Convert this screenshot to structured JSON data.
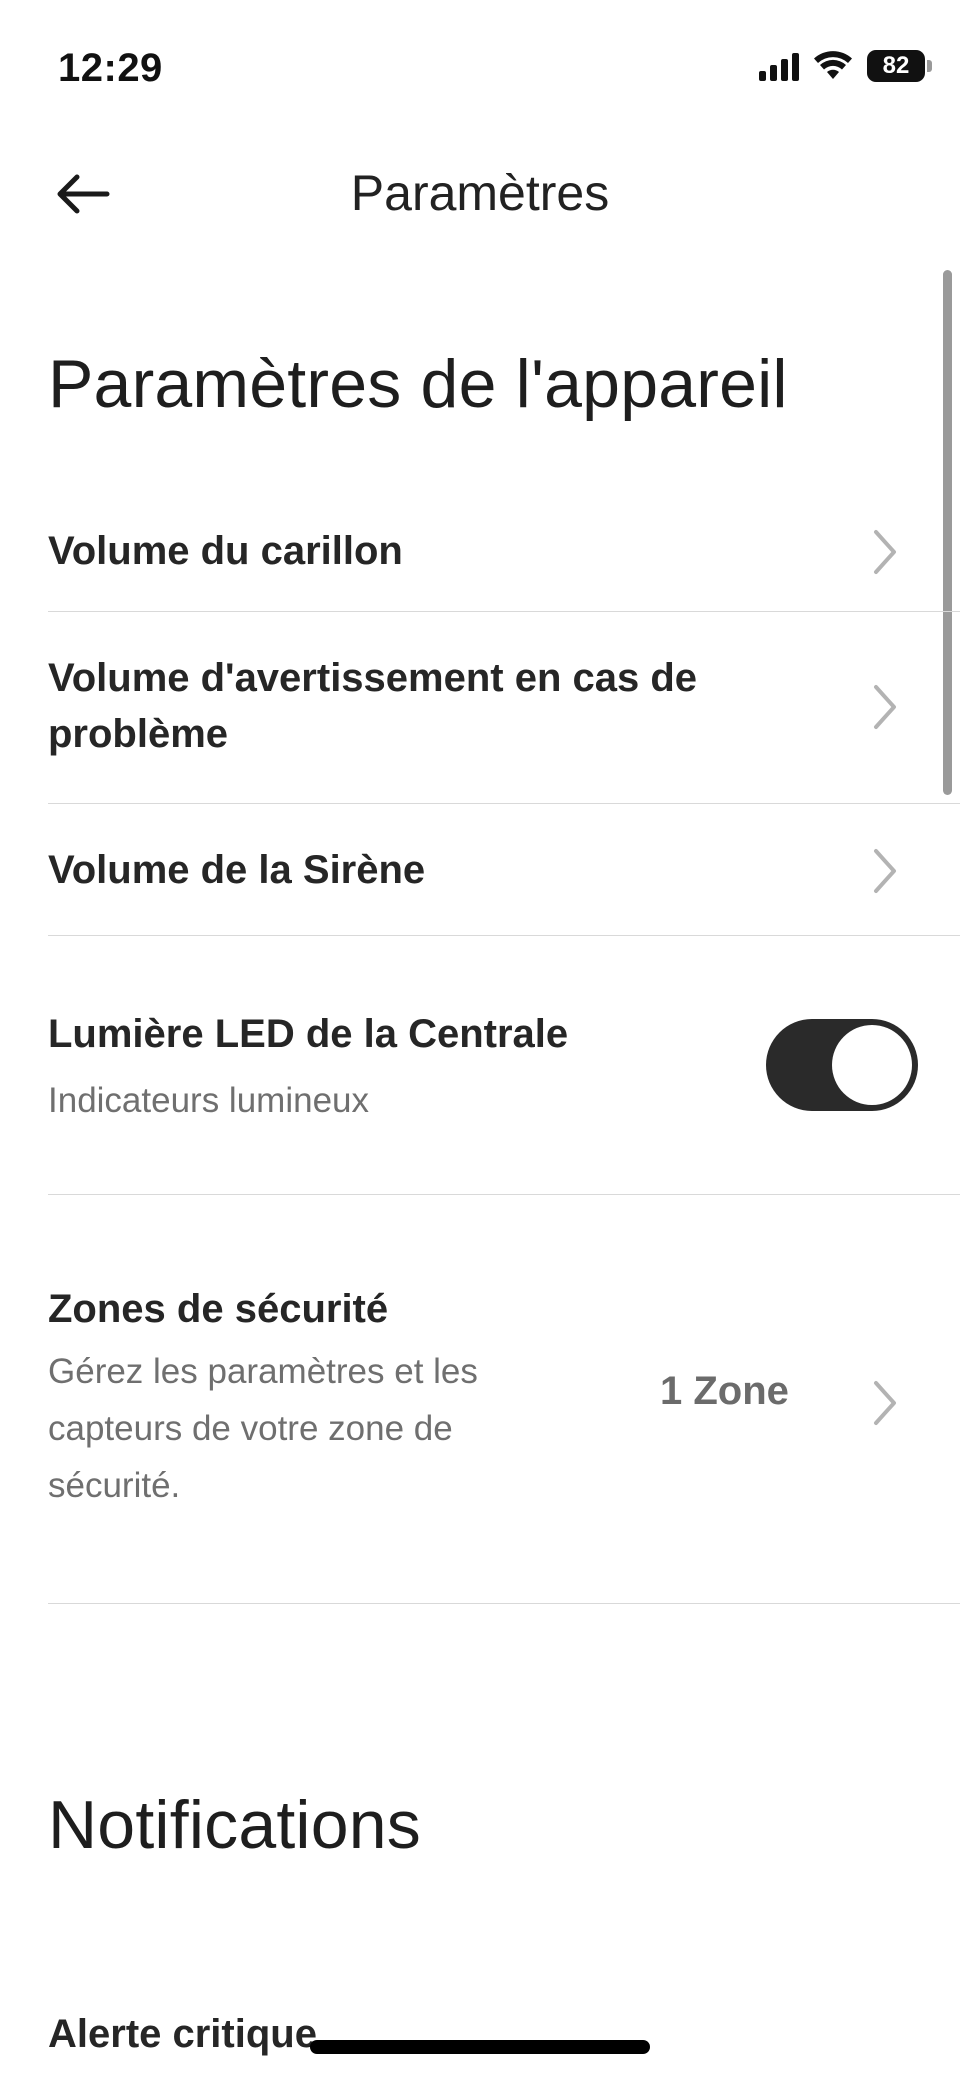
{
  "status_bar": {
    "time": "12:29",
    "battery": "82",
    "signal_icon": "cellular-signal-icon",
    "wifi_icon": "wifi-icon"
  },
  "nav": {
    "title": "Paramètres",
    "back_icon": "arrow-left-icon"
  },
  "device_settings": {
    "title": "Paramètres de l'appareil",
    "items": [
      {
        "label": "Volume du carillon"
      },
      {
        "label": "Volume d'avertissement en cas de problème"
      },
      {
        "label": "Volume de la Sirène"
      }
    ],
    "led": {
      "label": "Lumière LED de la Centrale",
      "subtitle": "Indicateurs lumineux",
      "enabled": true
    },
    "zones": {
      "label": "Zones de sécurité",
      "subtitle": "Gérez les paramètres et les capteurs de votre zone de sécurité.",
      "value": "1 Zone"
    }
  },
  "notifications": {
    "title": "Notifications",
    "items": [
      {
        "label": "Alerte critique"
      }
    ]
  },
  "colors": {
    "toggle_on": "#2a2a2a",
    "divider": "#d9d9d9",
    "chevron": "#b3b3b3"
  }
}
